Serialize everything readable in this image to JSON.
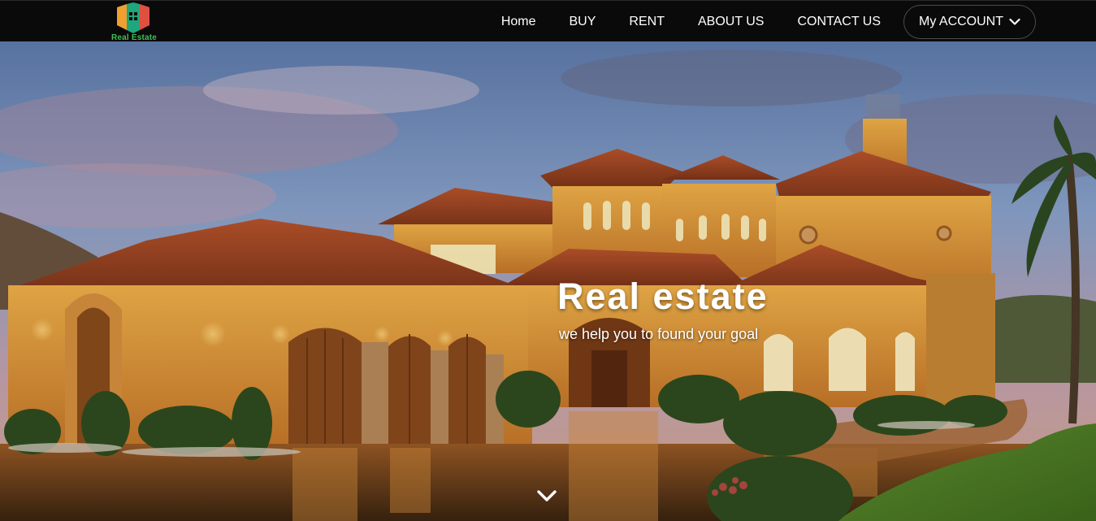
{
  "nav": {
    "brand_text": "Real Estate",
    "links": [
      "Home",
      "BUY",
      "RENT",
      "ABOUT US",
      "CONTACT US"
    ],
    "account_label": "My ACCOUNT",
    "account_icon": "chevron-down-icon"
  },
  "hero": {
    "title": "Real estate",
    "subtitle": "we help you to found your goal",
    "scroll_icon": "chevron-down-icon",
    "image_subject": ""
  },
  "colors": {
    "nav_bg": "#0a0a0a",
    "nav_text": "#ffffff",
    "brand_green": "#3fbf55",
    "logo_orange": "#f0a030",
    "logo_red": "#e05040",
    "logo_teal": "#1fa67a"
  }
}
